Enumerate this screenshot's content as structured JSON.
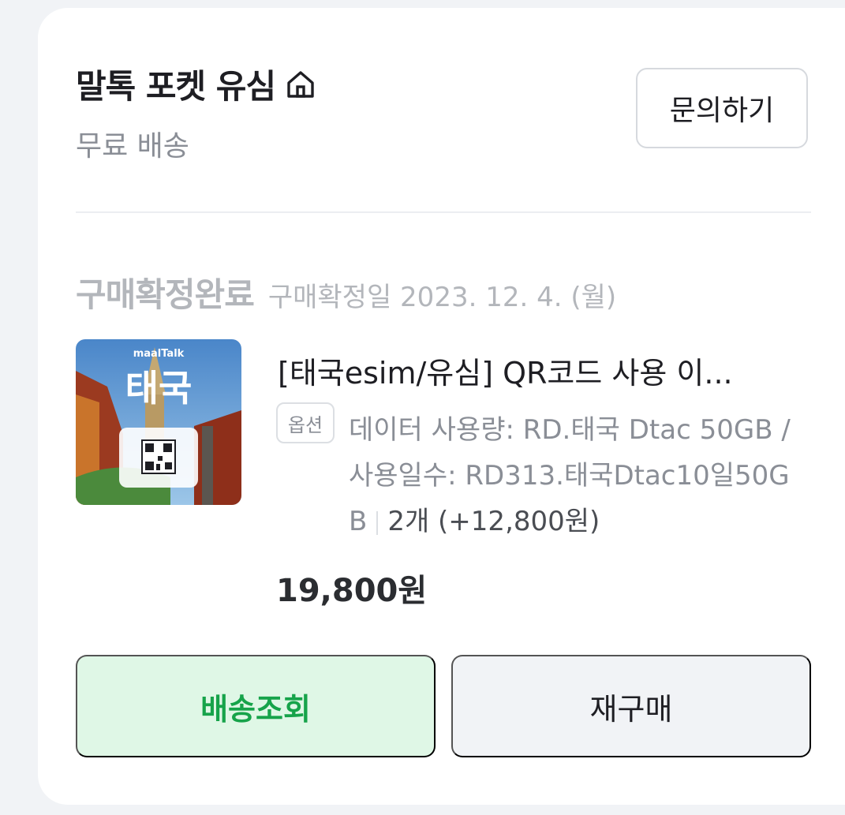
{
  "store": {
    "name": "말톡 포켓 유심",
    "shipping": "무료 배송",
    "inquiry_label": "문의하기",
    "home_icon": "home-icon"
  },
  "order": {
    "status": "구매확정완료",
    "confirm_date": "구매확정일 2023. 12. 4. (월)"
  },
  "product": {
    "thumbnail": {
      "brand": "maalTalk",
      "label": "태국"
    },
    "title": "[태국esim/유심] QR코드 사용 이...",
    "option_badge": "옵션",
    "option_text": "데이터 사용량: RD.태국 Dtac 50GB / 사용일수: RD313.태국Dtac10일50GB",
    "quantity": "2개 (+12,800원)",
    "price": "19,800원"
  },
  "actions": {
    "track_label": "배송조회",
    "rebuy_label": "재구매"
  },
  "colors": {
    "accent_green": "#16a34a",
    "track_bg": "#dff7e6"
  }
}
